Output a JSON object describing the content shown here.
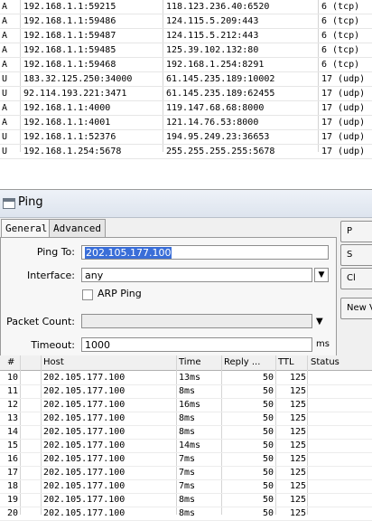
{
  "connections": [
    {
      "type": "A",
      "src": "192.168.1.1:59215",
      "dst": "118.123.236.40:6520",
      "proto": "6 (tcp)"
    },
    {
      "type": "A",
      "src": "192.168.1.1:59486",
      "dst": "124.115.5.209:443",
      "proto": "6 (tcp)"
    },
    {
      "type": "A",
      "src": "192.168.1.1:59487",
      "dst": "124.115.5.212:443",
      "proto": "6 (tcp)"
    },
    {
      "type": "A",
      "src": "192.168.1.1:59485",
      "dst": "125.39.102.132:80",
      "proto": "6 (tcp)"
    },
    {
      "type": "A",
      "src": "192.168.1.1:59468",
      "dst": "192.168.1.254:8291",
      "proto": "6 (tcp)"
    },
    {
      "type": "U",
      "src": "183.32.125.250:34000",
      "dst": "61.145.235.189:10002",
      "proto": "17 (udp)"
    },
    {
      "type": "U",
      "src": "92.114.193.221:3471",
      "dst": "61.145.235.189:62455",
      "proto": "17 (udp)"
    },
    {
      "type": "A",
      "src": "192.168.1.1:4000",
      "dst": "119.147.68.68:8000",
      "proto": "17 (udp)"
    },
    {
      "type": "A",
      "src": "192.168.1.1:4001",
      "dst": "121.14.76.53:8000",
      "proto": "17 (udp)"
    },
    {
      "type": "U",
      "src": "192.168.1.1:52376",
      "dst": "194.95.249.23:36653",
      "proto": "17 (udp)"
    },
    {
      "type": "U",
      "src": "192.168.1.254:5678",
      "dst": "255.255.255.255:5678",
      "proto": "17 (udp)"
    }
  ],
  "ping": {
    "title": "Ping",
    "tabs": {
      "general": "General",
      "advanced": "Advanced"
    },
    "labels": {
      "ping_to": "Ping To:",
      "interface": "Interface:",
      "arp_ping": "ARP Ping",
      "packet_count": "Packet Count:",
      "timeout": "Timeout:",
      "timeout_unit": "ms"
    },
    "values": {
      "ping_to": "202.105.177.100",
      "interface": "any",
      "packet_count": "",
      "timeout": "1000"
    },
    "buttons": {
      "b1": "P",
      "b2": "S",
      "b3": "Cl",
      "b4": "New V"
    }
  },
  "results": {
    "columns": {
      "num": "#",
      "host": "Host",
      "time": "Time",
      "reply": "Reply ...",
      "ttl": "TTL",
      "status": "Status"
    },
    "rows": [
      {
        "num": "10",
        "host": "202.105.177.100",
        "time": "13ms",
        "reply": "50",
        "ttl": "125"
      },
      {
        "num": "11",
        "host": "202.105.177.100",
        "time": "8ms",
        "reply": "50",
        "ttl": "125"
      },
      {
        "num": "12",
        "host": "202.105.177.100",
        "time": "16ms",
        "reply": "50",
        "ttl": "125"
      },
      {
        "num": "13",
        "host": "202.105.177.100",
        "time": "8ms",
        "reply": "50",
        "ttl": "125"
      },
      {
        "num": "14",
        "host": "202.105.177.100",
        "time": "8ms",
        "reply": "50",
        "ttl": "125"
      },
      {
        "num": "15",
        "host": "202.105.177.100",
        "time": "14ms",
        "reply": "50",
        "ttl": "125"
      },
      {
        "num": "16",
        "host": "202.105.177.100",
        "time": "7ms",
        "reply": "50",
        "ttl": "125"
      },
      {
        "num": "17",
        "host": "202.105.177.100",
        "time": "7ms",
        "reply": "50",
        "ttl": "125"
      },
      {
        "num": "18",
        "host": "202.105.177.100",
        "time": "7ms",
        "reply": "50",
        "ttl": "125"
      },
      {
        "num": "19",
        "host": "202.105.177.100",
        "time": "8ms",
        "reply": "50",
        "ttl": "125"
      },
      {
        "num": "20",
        "host": "202.105.177.100",
        "time": "8ms",
        "reply": "50",
        "ttl": "125"
      }
    ]
  }
}
